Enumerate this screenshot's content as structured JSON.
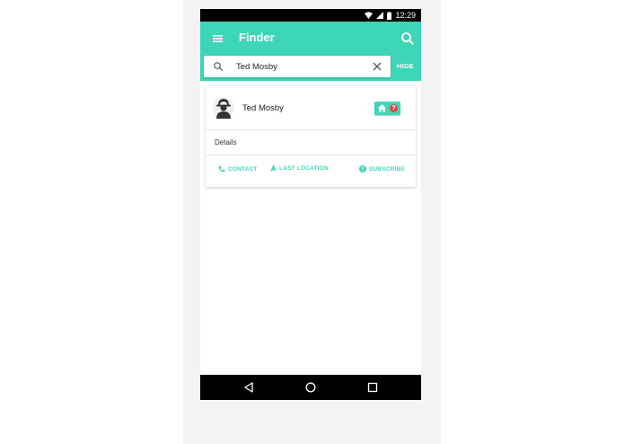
{
  "status_bar": {
    "time": "12:29"
  },
  "app_bar": {
    "title": "Finder"
  },
  "search": {
    "value": "Ted Mosby",
    "hide_label": "HIDE"
  },
  "result_card": {
    "name": "Ted Mosby",
    "badge_mark": "?",
    "details_label": "Details",
    "actions": {
      "contact": "CONTACT",
      "last_location": "LAST LOCATION",
      "subscribe": "SUBSCRIBE"
    }
  },
  "colors": {
    "accent": "#3dd6b7",
    "badge_alert": "#e04b3e",
    "status_bar": "#000000",
    "nav_bar": "#000000"
  },
  "icons": [
    "wifi-icon",
    "signal-icon",
    "battery-icon",
    "menu-icon",
    "search-icon",
    "clear-icon",
    "avatar-icon",
    "home-icon",
    "phone-icon",
    "navigation-icon",
    "info-icon",
    "back-icon",
    "home-circle-icon",
    "recents-icon"
  ]
}
